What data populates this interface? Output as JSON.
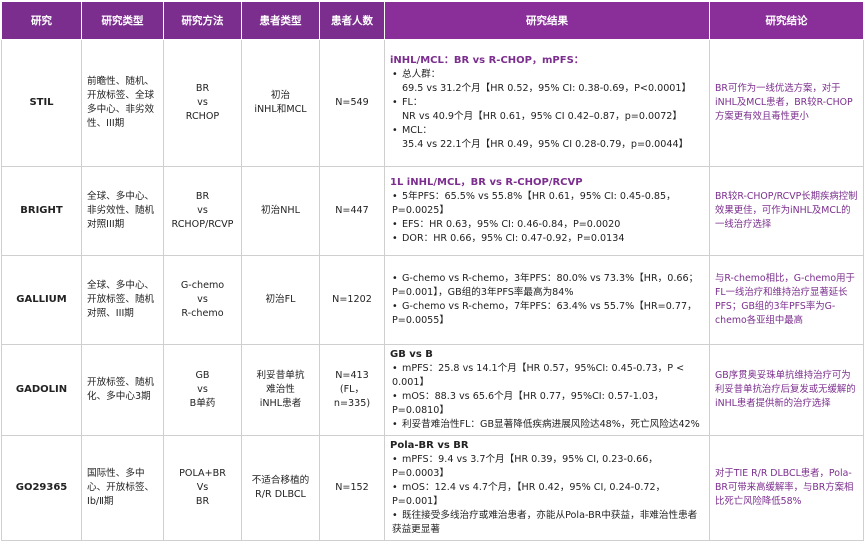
{
  "headers": [
    "研究",
    "研究类型",
    "研究方法",
    "患者类型",
    "患者人数",
    "研究结果",
    "研究结论"
  ],
  "rows": [
    {
      "study": "STIL",
      "type": "前瞻性、随机、开放标签、全球多中心、非劣效性、III期",
      "method": [
        "BR",
        "vs",
        "RCHOP"
      ],
      "patients": [
        "初治",
        "iNHL和MCL"
      ],
      "count": [
        "N=549"
      ],
      "results": {
        "title": "iNHL/MCL：BR vs R-CHOP，mPFS：",
        "lines": [
          {
            "bullet": "•",
            "text": "总人群："
          },
          {
            "bullet": "",
            "text": "69.5 vs 31.2个月【HR 0.52，95% CI: 0.38-0.69，P<0.0001】"
          },
          {
            "bullet": "•",
            "text": "FL："
          },
          {
            "bullet": "",
            "text": "NR vs 40.9个月【HR 0.61，95% CI 0.42–0.87，p=0.0072】"
          },
          {
            "bullet": "•",
            "text": "MCL："
          },
          {
            "bullet": "",
            "text": "35.4 vs 22.1个月【HR 0.49，95% CI 0.28-0.79，p=0.0044】"
          }
        ]
      },
      "conclusion": "BR可作为一线优选方案，对于iNHL及MCL患者，BR较R-CHOP方案更有效且毒性更小"
    },
    {
      "study": "BRIGHT",
      "type": "全球、多中心、非劣效性、随机对照III期",
      "method": [
        "BR",
        "vs",
        "RCHOP/RCVP"
      ],
      "patients": [
        "初治NHL"
      ],
      "count": [
        "N=447"
      ],
      "results": {
        "title": "1L iNHL/MCL，BR vs R-CHOP/RCVP",
        "lines": [
          {
            "bullet": "•",
            "text": "5年PFS：65.5% vs 55.8%【HR 0.61，95% CI: 0.45-0.85，P=0.0025】"
          },
          {
            "bullet": "•",
            "text": "EFS：HR 0.63，95% CI: 0.46-0.84，P=0.0020"
          },
          {
            "bullet": "•",
            "text": "DOR：HR 0.66，95% CI: 0.47-0.92，P=0.0134"
          }
        ]
      },
      "conclusion": "BR较R-CHOP/RCVP长期疾病控制效果更佳，可作为iNHL及MCL的一线治疗选择"
    },
    {
      "study": "GALLIUM",
      "type": "全球、多中心、开放标签、随机对照、III期",
      "method": [
        "G-chemo",
        "vs",
        "R-chemo"
      ],
      "patients": [
        "初治FL"
      ],
      "count": [
        "N=1202"
      ],
      "results": {
        "title": "",
        "lines": [
          {
            "bullet": "•",
            "text": "G-chemo vs R-chemo，3年PFS：80.0% vs 73.3%【HR，0.66；P=0.001】，GB组的3年PFS率最高为84%"
          },
          {
            "bullet": "•",
            "text": "G-chemo vs R-chemo，7年PFS：63.4% vs 55.7%【HR=0.77，P=0.0055】"
          }
        ]
      },
      "conclusion": "与R-chemo相比，G-chemo用于FL一线治疗和维持治疗显著延长PFS；GB组的3年PFS率为G-chemo各亚组中最高"
    },
    {
      "study": "GADOLIN",
      "type": "开放标签、随机化、多中心3期",
      "method": [
        "GB",
        "vs",
        "B单药"
      ],
      "patients": [
        "利妥昔单抗",
        "难治性",
        "iNHL患者"
      ],
      "count": [
        "N=413",
        "(FL，n=335)"
      ],
      "results": {
        "title": "GB vs B",
        "lines": [
          {
            "bullet": "•",
            "text": "mPFS：25.8 vs 14.1个月【HR 0.57，95%CI: 0.45-0.73，P < 0.001】"
          },
          {
            "bullet": "•",
            "text": "mOS：88.3 vs 65.6个月【HR 0.77，95%CI: 0.57-1.03，P=0.0810】"
          },
          {
            "bullet": "•",
            "text": "利妥昔难治性FL：GB显著降低疾病进展风险达48%，死亡风险达42%"
          }
        ]
      },
      "conclusion": "GB序贯奥妥珠单抗维持治疗可为利妥昔单抗治疗后复发或无缓解的iNHL患者提供新的治疗选择"
    },
    {
      "study": "GO29365",
      "type": "国际性、多中心、开放标签、Ⅰb/Ⅱ期",
      "method": [
        "POLA+BR",
        "Vs",
        "BR"
      ],
      "patients": [
        "不适合移植的",
        "R/R DLBCL"
      ],
      "count": [
        "N=152"
      ],
      "results": {
        "title": "Pola-BR vs BR",
        "lines": [
          {
            "bullet": "•",
            "text": "mPFS：9.4 vs 3.7个月【HR 0.39，95% CI, 0.23-0.66，P=0.0003】"
          },
          {
            "bullet": "•",
            "text": "mOS：12.4 vs 4.7个月，【HR 0.42，95% CI, 0.24-0.72，P=0.001】"
          },
          {
            "bullet": "•",
            "text": "既往接受多线治疗或难治患者，亦能从Pola-BR中获益，非难治性患者获益更显著"
          }
        ]
      },
      "conclusion": "对于TIE R/R DLBCL患者，Pola-BR可带来高缓解率，与BR方案相比死亡风险降低58%"
    }
  ],
  "colors": {
    "header_bg": "#7b2e8e",
    "highlight": "#7b2e8e",
    "border": "#cfcfcf"
  }
}
